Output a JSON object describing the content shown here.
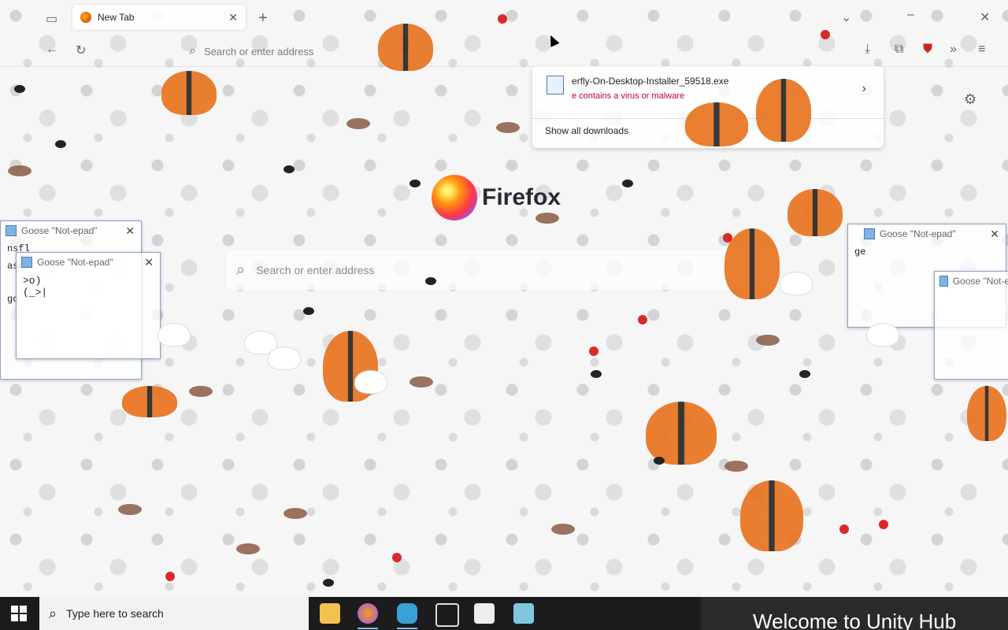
{
  "browser": {
    "tab_title": "New Tab",
    "url_placeholder": "Search or enter address"
  },
  "downloads": {
    "filename": "erfly-On-Desktop-Installer_59518.exe",
    "warning": "e contains a virus or malware",
    "show_all": "Show all downloads"
  },
  "newtab": {
    "brand": "Firefox",
    "search_placeholder": "Search or enter address"
  },
  "notepads": [
    {
      "title": "Goose \"Not-epad\"",
      "body": ""
    },
    {
      "title": "Goose \"Not-epad\"",
      "body": ">o)\n(_>|"
    },
    {
      "title": "Goose \"Not-epad\"",
      "body": ""
    },
    {
      "title": "Goose \"Not-epad\"",
      "body": ""
    }
  ],
  "notepad_fragments": {
    "left_a": "nsfl",
    "left_b": "asc",
    "left_c": "gc",
    "right_a": "ge"
  },
  "taskbar": {
    "search_placeholder": "Type here to search",
    "unity_text": "Welcome to Unity Hub"
  },
  "colors": {
    "accent": "#e66000",
    "warning": "#c50042",
    "taskbar": "#1c1c1e"
  }
}
